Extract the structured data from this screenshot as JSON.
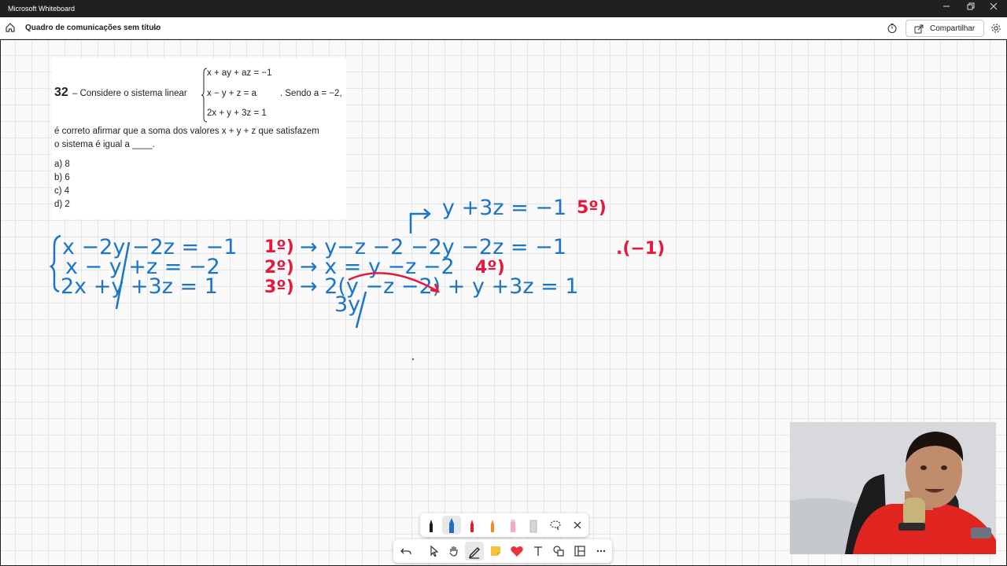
{
  "window": {
    "app_title": "Microsoft Whiteboard"
  },
  "header": {
    "board_title": "Quadro de comunicações sem título",
    "share_label": "Compartilhar"
  },
  "problem": {
    "number": "32",
    "lead": "– Considere o sistema linear",
    "equations": [
      "x + ay + az = −1",
      "x − y + z = a",
      "2x + y + 3z = 1"
    ],
    "condition": ". Sendo a = −2,",
    "text_line1": "é correto afirmar que a soma dos valores x + y + z que satisfazem",
    "text_line2": "o sistema é igual a ____.",
    "options": [
      "a) 8",
      "b) 6",
      "c) 4",
      "d) 2"
    ]
  },
  "handwriting": {
    "top_line": "y +3z = −1",
    "top_tag": "5º)",
    "system": [
      "x −2y −2z = −1",
      "x − y +z = −2",
      "2x +y +3z = 1"
    ],
    "step_tags": [
      "1º)",
      "2º)",
      "3º)"
    ],
    "step_lines": [
      "→ y−z −2 −2y −2z = −1",
      "→ x = y −z −2",
      "→ 2(y −z −2) + y +3z = 1"
    ],
    "multiplier": ".(−1)",
    "tag4": "4º)",
    "sub_note": "3y"
  },
  "toolbar": {
    "pens": [
      {
        "name": "black-pen",
        "color": "#1b1b1b"
      },
      {
        "name": "blue-pen",
        "color": "#1f6fc0"
      },
      {
        "name": "red-pen",
        "color": "#d9232d"
      },
      {
        "name": "orange-pen",
        "color": "#f08a24"
      },
      {
        "name": "pink-highlighter",
        "color": "#f7a8c0"
      },
      {
        "name": "eraser",
        "color": "#c9c9c9"
      }
    ],
    "tools": [
      "undo",
      "select",
      "pan",
      "pen",
      "sticky-note",
      "reactions",
      "text",
      "shapes",
      "templates",
      "more"
    ]
  },
  "colors": {
    "ink_blue": "#1a75c8",
    "ink_red": "#e8183a"
  }
}
